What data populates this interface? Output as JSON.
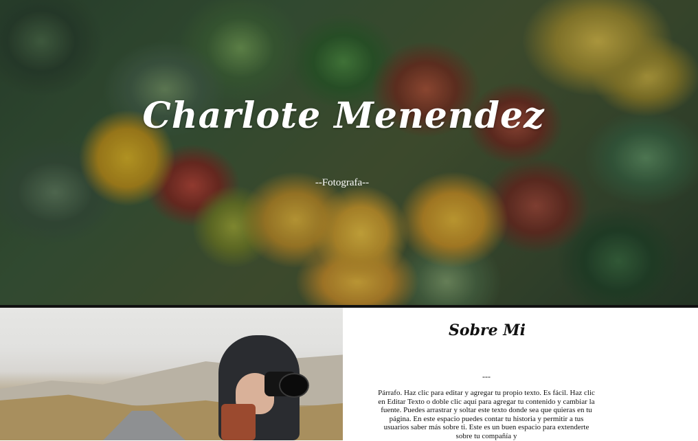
{
  "hero": {
    "title": "Charlote Menendez",
    "subtitle": "--Fotografa--"
  },
  "about": {
    "title": "Sobre Mi",
    "separator": "---",
    "body": "Párrafo. Haz clic para editar y agregar tu propio texto. Es fácil. Haz clic en Editar Texto o doble clic aquí para agregar tu contenido y cambiar la fuente. Puedes arrastrar y soltar este texto donde sea que quieras en tu página. En este espacio puedes contar tu historia y permitir a tus usuarios saber más sobre ti. Este es un buen espacio para extenderte sobre tu compañía y"
  },
  "colors": {
    "hero_text": "#ffffff",
    "divider": "#111111",
    "body_text": "#111111",
    "background": "#ffffff"
  }
}
